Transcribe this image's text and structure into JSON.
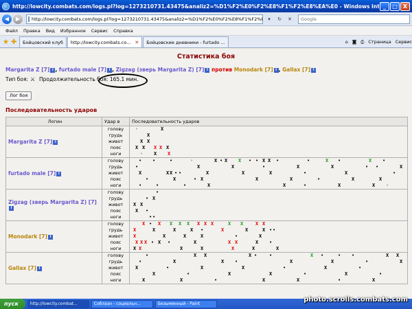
{
  "window": {
    "title": "http://lowcity.combats.com/logs.pl?log=1273210731.43475&analiz2=%D1%F2%E0%F2%E8%F1%F2%E8%EA%E0 - Windows Internet Explorer",
    "min": "_",
    "max": "□",
    "close": "X"
  },
  "address": {
    "url": "http://lowcity.combats.com/logs.pl?log=1273210731.43475&analiz2=%D1%F2%E0%F2%E8%F1%F2%E8%EA%E0",
    "search_placeholder": "Google"
  },
  "menu": [
    "Файл",
    "Правка",
    "Вид",
    "Избранное",
    "Сервис",
    "Справка"
  ],
  "tabs": [
    {
      "label": "Бойцовский клуб",
      "active": false
    },
    {
      "label": "http://lowcity.combats.co...",
      "active": true
    },
    {
      "label": "Бойцовские дневники - furtado ...",
      "active": false
    }
  ],
  "tab_tools": {
    "page": "Страница",
    "tools": "Сервис"
  },
  "page": {
    "heading": "Статистика боя",
    "fight_type_label": "Тип боя:",
    "duration_label": "Продолжительность боя:",
    "duration_value": "165.1 мин.",
    "log_button": "Лог боя",
    "seq_heading": "Последовательность ударов",
    "vs": "против",
    "team1": [
      "Margarita Z [7]",
      "furtado male [7]",
      "Zigzag (зверь Margarita Z) [7]"
    ],
    "team2": [
      "Monodark [7]",
      "Gallax [7]"
    ]
  },
  "table": {
    "headers": {
      "login": "Логин",
      "zone": "Удар в",
      "seq": "Последовательность ударов"
    },
    "zones": [
      "голову",
      "грудь",
      "живот",
      "пояс",
      "ноги"
    ],
    "colors": {
      "x_black": "#000000",
      "x_red": "#e00000",
      "x_green": "#1a9a1a",
      "dot_light": "#a9a9c8"
    },
    "rows": [
      {
        "login": "Margarita Z [7]",
        "color": "#6a5acd",
        "marks": [
          [
            [
              5,
              "d",
              "#a9a9c8"
            ],
            [
              42,
              "x",
              "#000000"
            ]
          ],
          [
            [
              22,
              "x",
              "#000000"
            ]
          ],
          [
            [
              12,
              "x",
              "#000000"
            ],
            [
              22,
              "x",
              "#000000"
            ]
          ],
          [
            [
              5,
              "x",
              "#000000"
            ],
            [
              15,
              "x",
              "#000000"
            ],
            [
              32,
              "x",
              "#e00000"
            ],
            [
              40,
              "x",
              "#e00000"
            ],
            [
              50,
              "x",
              "#000000"
            ]
          ],
          [
            [
              12,
              "d",
              "#a9a9c8"
            ],
            [
              32,
              "x",
              "#000000"
            ],
            [
              52,
              "x",
              "#e00000"
            ]
          ]
        ]
      },
      {
        "login": "furtado male [7]",
        "color": "#6a5acd",
        "marks": [
          [
            [
              10,
              "d",
              "#000000"
            ],
            [
              30,
              "d",
              "#000000"
            ],
            [
              55,
              "d",
              "#000000"
            ],
            [
              85,
              "d",
              "#a9a9c8"
            ],
            [
              120,
              "x",
              "#000000"
            ],
            [
              128,
              "d",
              "#000000"
            ],
            [
              135,
              "x",
              "#000000"
            ],
            [
              155,
              "x",
              "#1a9a1a"
            ],
            [
              170,
              "d",
              "#000000"
            ],
            [
              180,
              "d",
              "#000000"
            ],
            [
              190,
              "x",
              "#000000"
            ],
            [
              198,
              "x",
              "#000000"
            ],
            [
              210,
              "d",
              "#000000"
            ],
            [
              255,
              "d",
              "#000000"
            ],
            [
              282,
              "x",
              "#1a9a1a"
            ],
            [
              300,
              "d",
              "#000000"
            ],
            [
              345,
              "x",
              "#1a9a1a"
            ],
            [
              365,
              "d",
              "#000000"
            ]
          ],
          [
            [
              5,
              "d",
              "#000000"
            ],
            [
              95,
              "x",
              "#000000"
            ],
            [
              145,
              "x",
              "#000000"
            ],
            [
              190,
              "d",
              "#000000"
            ],
            [
              240,
              "x",
              "#000000"
            ],
            [
              290,
              "x",
              "#000000"
            ],
            [
              340,
              "d",
              "#000000"
            ],
            [
              355,
              "d",
              "#000000"
            ],
            [
              390,
              "x",
              "#000000"
            ]
          ],
          [
            [
              10,
              "x",
              "#000000"
            ],
            [
              50,
              "x",
              "#000000"
            ],
            [
              55,
              "x",
              "#000000"
            ],
            [
              62,
              "d",
              "#000000"
            ],
            [
              68,
              "d",
              "#000000"
            ],
            [
              108,
              "x",
              "#000000"
            ],
            [
              160,
              "x",
              "#000000"
            ],
            [
              200,
              "x",
              "#000000"
            ],
            [
              250,
              "d",
              "#000000"
            ],
            [
              310,
              "x",
              "#000000"
            ],
            [
              380,
              "d",
              "#000000"
            ]
          ],
          [
            [
              20,
              "d",
              "#000000"
            ],
            [
              60,
              "x",
              "#000000"
            ],
            [
              90,
              "d",
              "#000000"
            ],
            [
              100,
              "x",
              "#000000"
            ],
            [
              180,
              "x",
              "#000000"
            ],
            [
              230,
              "x",
              "#000000"
            ],
            [
              270,
              "d",
              "#000000"
            ],
            [
              320,
              "x",
              "#000000"
            ],
            [
              360,
              "x",
              "#000000"
            ]
          ],
          [
            [
              10,
              "d",
              "#000000"
            ],
            [
              35,
              "d",
              "#000000"
            ],
            [
              75,
              "d",
              "#000000"
            ],
            [
              110,
              "x",
              "#000000"
            ],
            [
              220,
              "x",
              "#000000"
            ],
            [
              250,
              "d",
              "#000000"
            ],
            [
              300,
              "x",
              "#000000"
            ],
            [
              350,
              "x",
              "#000000"
            ],
            [
              370,
              "d",
              "#a9a9c8"
            ]
          ]
        ]
      },
      {
        "login": "Zigzag (зверь Margarita Z) [7]",
        "color": "#6a5acd",
        "marks": [
          [
            [
              35,
              "d",
              "#000000"
            ]
          ],
          [
            [
              20,
              "d",
              "#000000"
            ],
            [
              30,
              "x",
              "#000000"
            ]
          ],
          [
            [
              2,
              "x",
              "#000000"
            ],
            [
              12,
              "x",
              "#000000"
            ]
          ],
          [
            [
              5,
              "x",
              "#000000"
            ],
            [
              20,
              "d",
              "#000000"
            ]
          ],
          [
            [
              25,
              "d",
              "#000000"
            ],
            [
              30,
              "d",
              "#000000"
            ]
          ]
        ]
      },
      {
        "login": "Monodark [7]",
        "color": "#b8860b",
        "marks": [
          [
            [
              15,
              "x",
              "#e00000"
            ],
            [
              25,
              "d",
              "#000000"
            ],
            [
              38,
              "x",
              "#e00000"
            ],
            [
              55,
              "x",
              "#1a9a1a"
            ],
            [
              68,
              "x",
              "#1a9a1a"
            ],
            [
              80,
              "x",
              "#1a9a1a"
            ],
            [
              95,
              "x",
              "#e00000"
            ],
            [
              105,
              "x",
              "#e00000"
            ],
            [
              115,
              "x",
              "#e00000"
            ],
            [
              140,
              "x",
              "#1a9a1a"
            ],
            [
              158,
              "x",
              "#1a9a1a"
            ],
            [
              180,
              "x",
              "#e00000"
            ],
            [
              190,
              "x",
              "#e00000"
            ]
          ],
          [
            [
              2,
              "x",
              "#e00000"
            ],
            [
              30,
              "x",
              "#000000"
            ],
            [
              60,
              "x",
              "#000000"
            ],
            [
              85,
              "x",
              "#000000"
            ],
            [
              100,
              "d",
              "#000000"
            ],
            [
              130,
              "x",
              "#e00000"
            ],
            [
              165,
              "x",
              "#000000"
            ],
            [
              190,
              "x",
              "#000000"
            ],
            [
              200,
              "d",
              "#000000"
            ],
            [
              205,
              "d",
              "#000000"
            ]
          ],
          [
            [
              2,
              "x",
              "#e00000"
            ],
            [
              45,
              "x",
              "#000000"
            ],
            [
              75,
              "x",
              "#000000"
            ],
            [
              100,
              "x",
              "#000000"
            ],
            [
              150,
              "d",
              "#000000"
            ],
            [
              185,
              "x",
              "#000000"
            ]
          ],
          [
            [
              5,
              "x",
              "#e00000"
            ],
            [
              12,
              "x",
              "#e00000"
            ],
            [
              18,
              "x",
              "#e00000"
            ],
            [
              28,
              "d",
              "#000000"
            ],
            [
              38,
              "x",
              "#000000"
            ],
            [
              52,
              "d",
              "#000000"
            ],
            [
              90,
              "x",
              "#000000"
            ],
            [
              140,
              "x",
              "#e00000"
            ],
            [
              150,
              "x",
              "#e00000"
            ],
            [
              180,
              "x",
              "#000000"
            ],
            [
              200,
              "d",
              "#000000"
            ]
          ],
          [
            [
              2,
              "x",
              "#000000"
            ],
            [
              10,
              "x",
              "#e00000"
            ],
            [
              70,
              "x",
              "#000000"
            ],
            [
              100,
              "x",
              "#000000"
            ],
            [
              145,
              "x",
              "#e00000"
            ],
            [
              175,
              "x",
              "#000000"
            ],
            [
              210,
              "x",
              "#000000"
            ]
          ]
        ]
      },
      {
        "login": "Gallax [7]",
        "color": "#b8860b",
        "marks": [
          [
            [
              20,
              "d",
              "#000000"
            ],
            [
              90,
              "x",
              "#000000"
            ],
            [
              105,
              "x",
              "#000000"
            ],
            [
              170,
              "x",
              "#000000"
            ],
            [
              178,
              "d",
              "#000000"
            ],
            [
              200,
              "d",
              "#000000"
            ],
            [
              260,
              "x",
              "#1a9a1a"
            ],
            [
              275,
              "d",
              "#000000"
            ],
            [
              300,
              "d",
              "#000000"
            ],
            [
              320,
              "d",
              "#000000"
            ],
            [
              370,
              "x",
              "#000000"
            ],
            [
              385,
              "x",
              "#000000"
            ]
          ],
          [
            [
              10,
              "d",
              "#000000"
            ],
            [
              60,
              "x",
              "#000000"
            ],
            [
              130,
              "x",
              "#000000"
            ],
            [
              150,
              "d",
              "#000000"
            ],
            [
              230,
              "x",
              "#000000"
            ],
            [
              290,
              "x",
              "#000000"
            ],
            [
              340,
              "d",
              "#000000"
            ],
            [
              390,
              "x",
              "#000000"
            ]
          ],
          [
            [
              5,
              "x",
              "#000000"
            ],
            [
              50,
              "d",
              "#000000"
            ],
            [
              100,
              "x",
              "#000000"
            ],
            [
              160,
              "x",
              "#000000"
            ],
            [
              220,
              "d",
              "#000000"
            ],
            [
              280,
              "x",
              "#000000"
            ],
            [
              330,
              "d",
              "#000000"
            ]
          ],
          [
            [
              30,
              "x",
              "#000000"
            ],
            [
              80,
              "d",
              "#000000"
            ],
            [
              140,
              "x",
              "#000000"
            ],
            [
              200,
              "x",
              "#000000"
            ],
            [
              250,
              "d",
              "#000000"
            ],
            [
              310,
              "x",
              "#000000"
            ],
            [
              360,
              "d",
              "#000000"
            ]
          ],
          [
            [
              15,
              "x",
              "#000000"
            ],
            [
              70,
              "x",
              "#000000"
            ],
            [
              120,
              "d",
              "#000000"
            ],
            [
              190,
              "x",
              "#000000"
            ],
            [
              240,
              "x",
              "#000000"
            ],
            [
              300,
              "d",
              "#000000"
            ],
            [
              350,
              "x",
              "#000000"
            ]
          ]
        ]
      }
    ]
  },
  "taskbar": {
    "start": "пуск",
    "items": [
      {
        "label": "http://lowcity.combat...",
        "active": true
      },
      {
        "label": "Соблазн - социальн...",
        "active": false
      },
      {
        "label": "Безымянный - Paint",
        "active": false
      }
    ]
  },
  "watermark": "photo.scrolls.combats.com"
}
